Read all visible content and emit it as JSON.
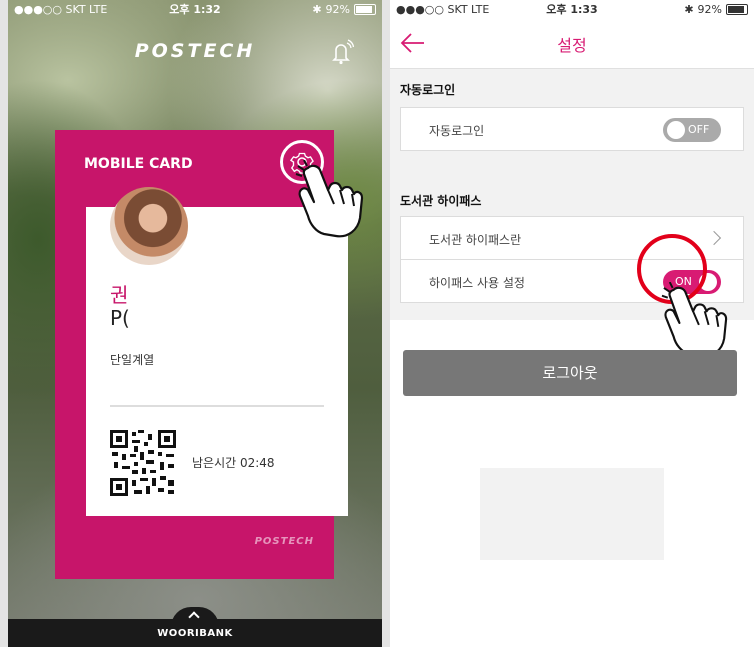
{
  "left_screen": {
    "status": {
      "carrier": "●●●○○ SKT  LTE",
      "time": "오후 1:32",
      "battery": "92%"
    },
    "logo": "POSTECH",
    "card": {
      "title": "MOBILE CARD",
      "name_korean": "권",
      "name_english": "P(",
      "department": "단일계열",
      "remaining_time": "남은시간 02:48",
      "footer_logo": "POSTECH"
    },
    "bottom_bar": {
      "label": "WOORIBANK"
    }
  },
  "right_screen": {
    "status": {
      "carrier": "●●●○○ SKT  LTE",
      "time": "오후 1:33",
      "battery": "92%"
    },
    "header": {
      "title": "설정"
    },
    "sections": [
      {
        "label": "자동로그인",
        "rows": [
          {
            "label": "자동로그인",
            "toggle": "OFF"
          }
        ]
      },
      {
        "label": "도서관 하이패스",
        "rows": [
          {
            "label": "도서관 하이패스란"
          },
          {
            "label": "하이패스 사용 설정",
            "toggle": "ON"
          }
        ]
      }
    ],
    "logout_label": "로그아웃"
  },
  "colors": {
    "brand_pink": "#c7156a",
    "toggle_on": "#d81b73",
    "highlight_ring": "#e2001a"
  },
  "icons": [
    "bell-icon",
    "gear-icon",
    "back-arrow-icon",
    "chevron-right-icon",
    "qr-code-icon",
    "tap-hand-icon",
    "chevron-up-icon"
  ]
}
